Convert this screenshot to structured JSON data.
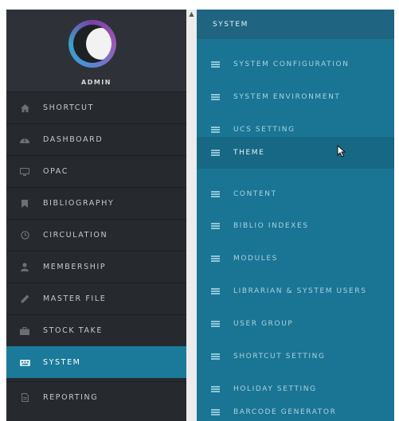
{
  "sidebar": {
    "user": "ADMIN",
    "items": [
      {
        "label": "SHORTCUT",
        "icon": "home-icon",
        "active": false
      },
      {
        "label": "DASHBOARD",
        "icon": "dashboard-icon",
        "active": false
      },
      {
        "label": "OPAC",
        "icon": "monitor-icon",
        "active": false
      },
      {
        "label": "BIBLIOGRAPHY",
        "icon": "bookmark-icon",
        "active": false
      },
      {
        "label": "CIRCULATION",
        "icon": "clock-icon",
        "active": false
      },
      {
        "label": "MEMBERSHIP",
        "icon": "user-icon",
        "active": false
      },
      {
        "label": "MASTER FILE",
        "icon": "pencil-icon",
        "active": false
      },
      {
        "label": "STOCK TAKE",
        "icon": "briefcase-icon",
        "active": false
      },
      {
        "label": "SYSTEM",
        "icon": "keyboard-icon",
        "active": true
      },
      {
        "label": "REPORTING",
        "icon": "file-icon",
        "active": false
      }
    ]
  },
  "submenu": {
    "header": "SYSTEM",
    "items": [
      {
        "label": "SYSTEM CONFIGURATION"
      },
      {
        "label": "SYSTEM ENVIRONMENT"
      },
      {
        "label": "UCS SETTING"
      },
      {
        "label": "THEME"
      },
      {
        "label": "CONTENT"
      },
      {
        "label": "BIBLIO INDEXES"
      },
      {
        "label": "MODULES"
      },
      {
        "label": "LIBRARIAN & SYSTEM USERS"
      },
      {
        "label": "USER GROUP"
      },
      {
        "label": "SHORTCUT SETTING"
      },
      {
        "label": "HOLIDAY SETTING"
      },
      {
        "label": "BARCODE GENERATOR"
      }
    ]
  },
  "colors": {
    "sidebar_bg": "#26292e",
    "active_bg": "#1b7a9a",
    "submenu_bg": "#1a7594",
    "submenu_header_bg": "#1f6481"
  }
}
